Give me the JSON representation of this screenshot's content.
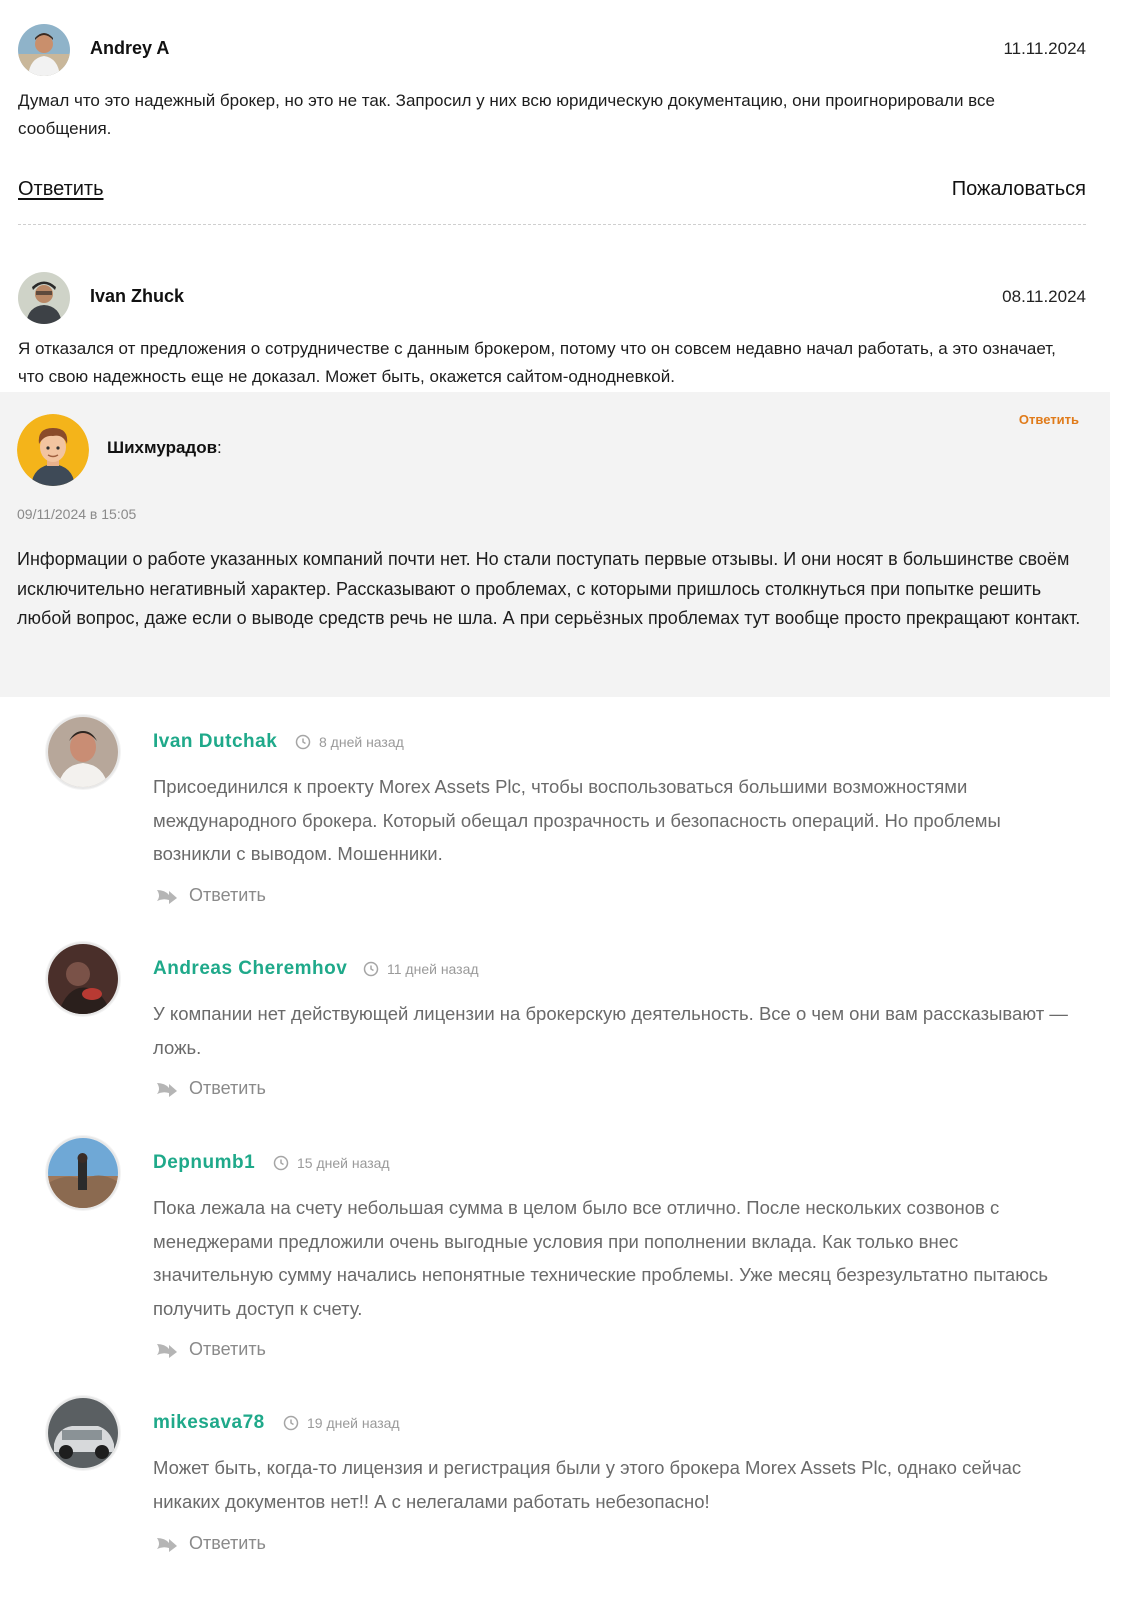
{
  "reviews": [
    {
      "author": "Andrey A",
      "date": "11.11.2024",
      "text": "Думал что это надежный брокер, но это не так. Запросил у них всю юридическую документацию, они проигнорировали все сообщения.",
      "reply_label": "Ответить",
      "complain_label": "Пожаловаться"
    },
    {
      "author": "Ivan Zhuck",
      "date": "08.11.2024",
      "text": "Я отказался от предложения о сотрудничестве с данным брокером, потому что он совсем недавно начал работать, а это означает, что свою надежность еще не доказал. Может быть, окажется сайтом-однодневкой."
    }
  ],
  "grey_comment": {
    "author": "Шихмурадов",
    "colon": ":",
    "reply_label": "Ответить",
    "date": "09/11/2024 в 15:05",
    "text": "Информации о работе указанных компаний почти нет. Но стали поступать первые отзывы. И они носят в большинстве своём исключительно негативный характер. Рассказывают о проблемах, с которыми пришлось столкнуться при попытке решить любой вопрос, даже если о выводе средств речь не шла. А при серьёзных проблемах тут вообще просто прекращают контакт."
  },
  "comments": [
    {
      "author": "Ivan Dutchak",
      "time": "8 дней назад",
      "text": "Присоединился к проекту Morex Assets Plc, чтобы воспользоваться большими возможностями международного брокера. Который обещал прозрачность и безопасность операций. Но проблемы возникли с выводом. Мошенники.",
      "reply_label": "Ответить"
    },
    {
      "author": "Andreas Cheremhov",
      "time": "11 дней назад",
      "text": "У компании нет действующей лицензии на брокерскую деятельность. Все о чем они вам рассказывают — ложь.",
      "reply_label": "Ответить"
    },
    {
      "author": "Depnumb1",
      "time": "15 дней назад",
      "text": "Пока лежала на счету небольшая сумма в целом было все отлично. После нескольких созвонов с менеджерами предложили очень выгодные условия при пополнении вклада. Как только внес значительную сумму начались непонятные технические проблемы. Уже месяц безрезультатно пытаюсь получить доступ к счету.",
      "reply_label": "Ответить"
    },
    {
      "author": "mikesava78",
      "time": "19 дней назад",
      "text": "Может быть, когда-то лицензия и регистрация были у этого брокера Morex Assets Plc, однако сейчас никаких документов нет!! А с нелегалами работать небезопасно!",
      "reply_label": "Ответить"
    }
  ],
  "colors": {
    "comment_name": "#1fa98a",
    "grey_reply": "#e07b1a",
    "grey_bg": "#f3f3f3"
  },
  "icons": [
    "user-avatar-photo",
    "cartoon-avatar",
    "clock-icon",
    "reply-arrow-icon"
  ]
}
